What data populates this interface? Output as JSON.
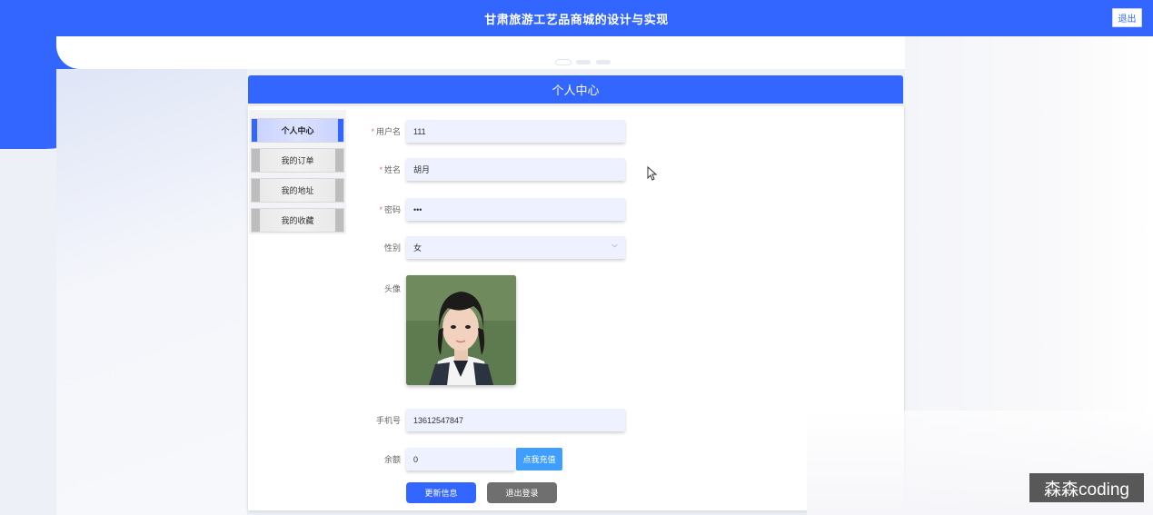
{
  "app": {
    "title": "甘肃旅游工艺品商城的设计与实现",
    "logout_label": "退出"
  },
  "section": {
    "title": "个人中心"
  },
  "sidebar": {
    "items": [
      {
        "label": "个人中心",
        "active": true
      },
      {
        "label": "我的订单",
        "active": false
      },
      {
        "label": "我的地址",
        "active": false
      },
      {
        "label": "我的收藏",
        "active": false
      }
    ]
  },
  "form": {
    "username": {
      "label": "用户名",
      "value": "111",
      "required": true
    },
    "name": {
      "label": "姓名",
      "value": "胡月",
      "required": true
    },
    "password": {
      "label": "密码",
      "value": "•••",
      "required": true
    },
    "gender": {
      "label": "性别",
      "value": "女"
    },
    "avatar": {
      "label": "头像"
    },
    "phone": {
      "label": "手机号",
      "value": "13612547847"
    },
    "balance": {
      "label": "余额",
      "value": "0",
      "topup_label": "点我充值"
    }
  },
  "actions": {
    "update_label": "更新信息",
    "logout_label": "退出登录"
  },
  "watermark": {
    "text": "森森coding"
  },
  "colors": {
    "primary": "#3366ff",
    "topup": "#409eff",
    "secondary": "#6f6f6f",
    "required": "#f56c6c"
  }
}
